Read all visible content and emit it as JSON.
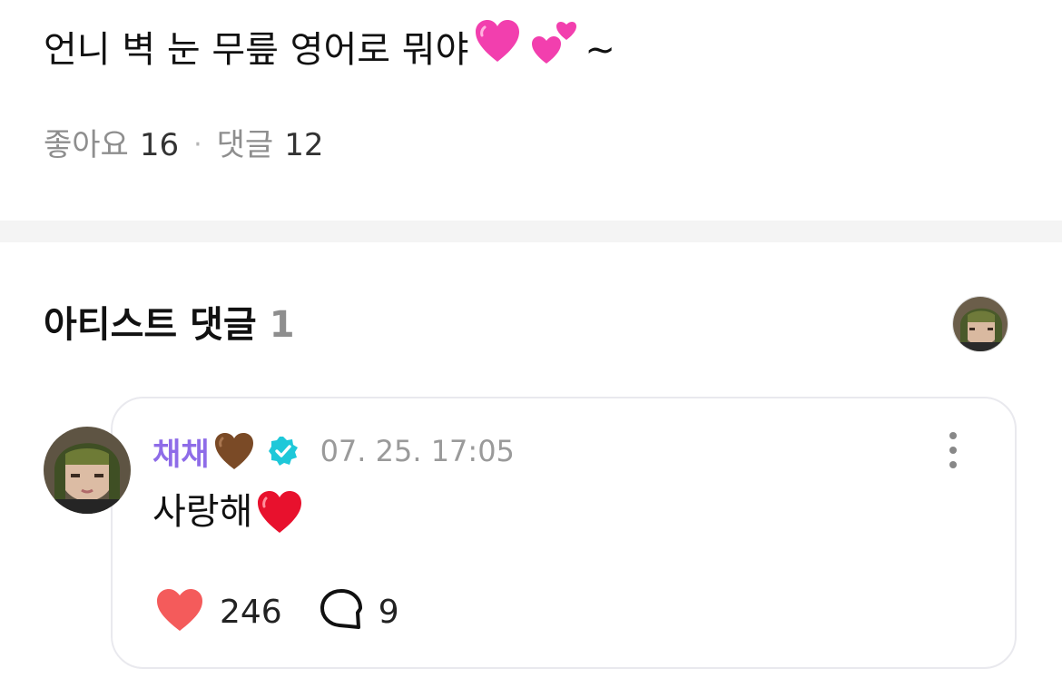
{
  "post": {
    "body_text": "언니 벽 눈 무릎 영어로 뭐야",
    "body_suffix": "~",
    "emojis": [
      "growing-heart-emoji",
      "two-hearts-emoji"
    ],
    "likes_label": "좋아요",
    "likes_count": "16",
    "separator": "·",
    "comments_label": "댓글",
    "comments_count": "12"
  },
  "artist_comments": {
    "title": "아티스트 댓글",
    "count": "1",
    "comment": {
      "author": "채채",
      "author_emoji": "brown-heart-emoji",
      "verified": true,
      "timestamp": "07. 25. 17:05",
      "text": "사랑해",
      "text_emoji": "red-heart-emoji",
      "like_count": "246",
      "reply_count": "9"
    }
  },
  "colors": {
    "author_name": "#8e6ce8",
    "verified_badge": "#1ec8d9",
    "like_heart": "#f45b5b",
    "muted_text": "#8e8e8e",
    "divider_band": "#f4f4f4",
    "card_border": "#e9e9ee"
  }
}
